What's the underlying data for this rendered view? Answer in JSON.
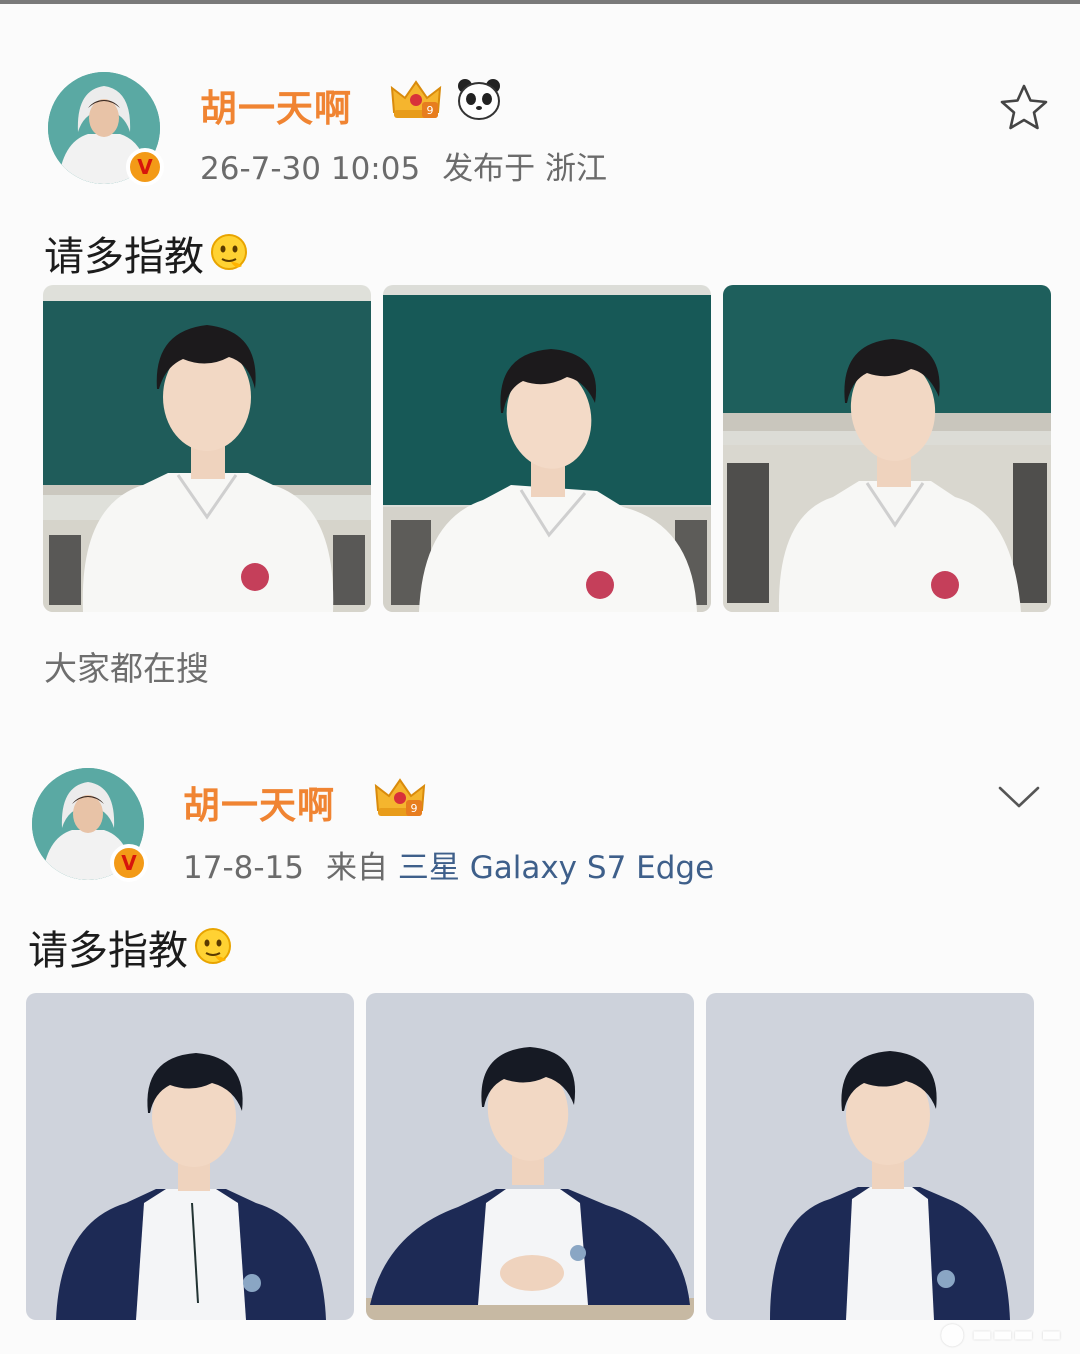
{
  "posts": [
    {
      "username": "胡一天啊",
      "timestamp": "26-7-30 10:05",
      "location_prefix": "发布于",
      "location": "浙江",
      "content": "请多指教",
      "footer_hint": "大家都在搜",
      "photos": [
        "classroom-white-polo-1",
        "classroom-white-polo-2",
        "classroom-white-polo-3"
      ],
      "action_icon": "star-outline-icon"
    },
    {
      "username": "胡一天啊",
      "timestamp": "17-8-15",
      "source_prefix": "来自",
      "source": "三星 Galaxy S7 Edge",
      "content": "请多指教",
      "photos": [
        "studio-navy-jacket-1",
        "studio-navy-jacket-2",
        "studio-navy-jacket-3"
      ],
      "action_icon": "chevron-down-icon"
    }
  ],
  "colors": {
    "username": "#f08432",
    "meta": "#6b6b6b",
    "device_link": "#3e5f8a",
    "verified_badge": "#f39a17",
    "background": "#fbfbfb"
  }
}
